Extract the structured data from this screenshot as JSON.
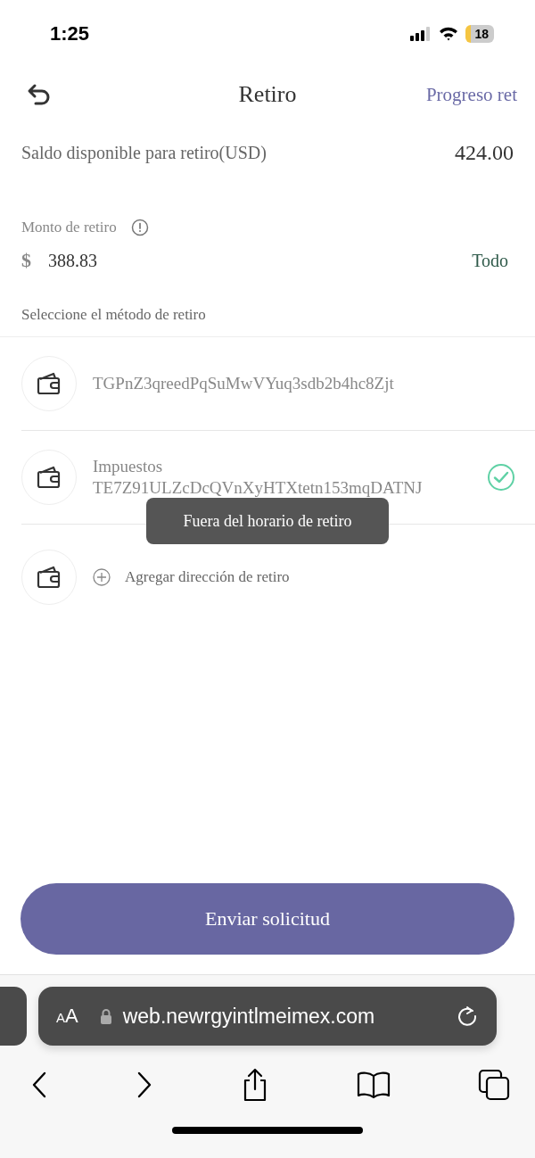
{
  "status_bar": {
    "time": "1:25",
    "battery": "18"
  },
  "header": {
    "title": "Retiro",
    "action": "Progreso ret"
  },
  "balance": {
    "label": "Saldo disponible para retiro(USD)",
    "value": "424.00"
  },
  "amount": {
    "label": "Monto de retiro",
    "currency": "$",
    "value": "388.83",
    "all_label": "Todo"
  },
  "methods_title": "Seleccione el método de retiro",
  "methods": [
    {
      "kind": "address",
      "address": "TGPnZ3qreedPqSuMwVYuq3sdb2b4hc8Zjt",
      "selected": false
    },
    {
      "kind": "address",
      "name": "Impuestos",
      "address": "TE7Z91ULZcDcQVnXyHTXtetn153mqDATNJ",
      "selected": true
    },
    {
      "kind": "add",
      "label": "Agregar dirección de retiro"
    }
  ],
  "toast": "Fuera del horario de retiro",
  "submit": "Enviar solicitud",
  "browser": {
    "text_size": "AA",
    "url": "web.newrgyintlmeimex.com"
  }
}
